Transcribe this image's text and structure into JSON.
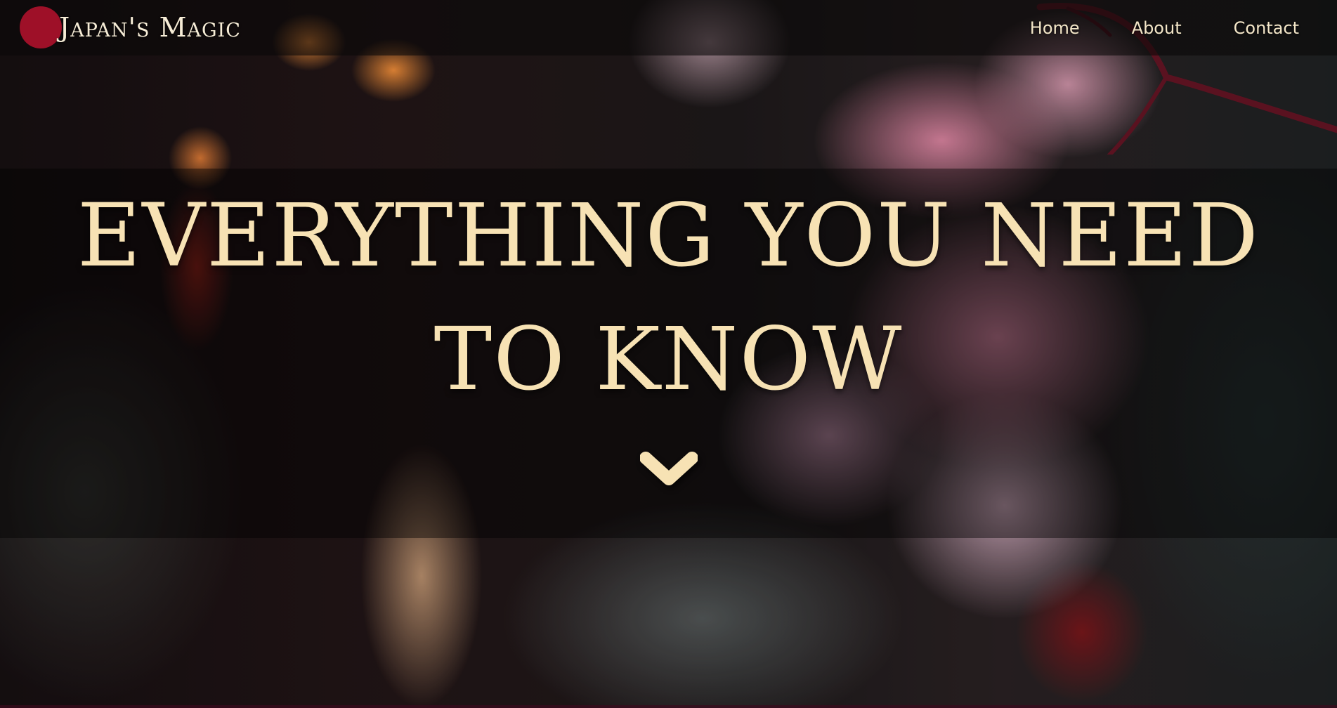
{
  "brand": {
    "name": "Japan's Magic",
    "logo_icon": "rising-sun-circle",
    "logo_color": "#9e1028"
  },
  "nav": {
    "items": [
      {
        "label": "Home"
      },
      {
        "label": "About"
      },
      {
        "label": "Contact"
      }
    ]
  },
  "hero": {
    "title": "EVERYTHING YOU NEED TO KNOW",
    "scroll_icon": "chevron-down-icon",
    "title_color": "#f7e2b4"
  },
  "background": {
    "subject": "cherry-blossom-branch",
    "accent_color": "#e88caa"
  }
}
